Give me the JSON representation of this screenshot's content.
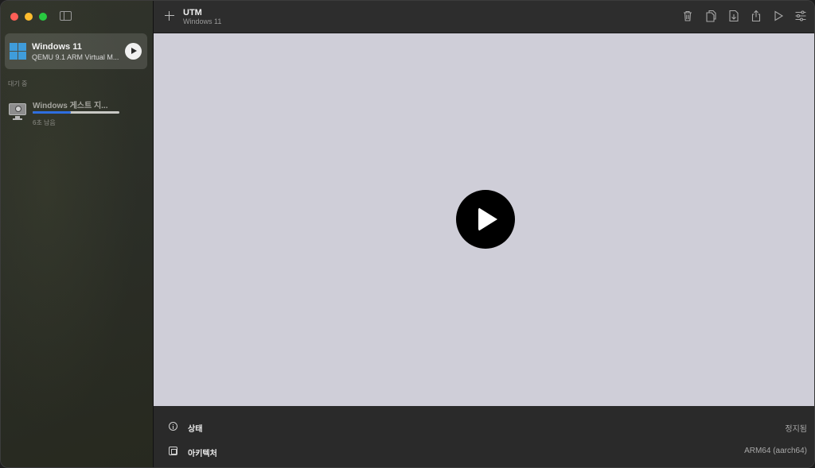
{
  "sidebar": {
    "vm_selected": {
      "name": "Windows 11",
      "subtitle": "QEMU 9.1 ARM Virtual M...",
      "icon": "windows-logo-icon"
    },
    "section_label": "대기 중",
    "download": {
      "title": "Windows 게스트 지...",
      "eta": "6초 남음",
      "progress": 0.44,
      "icon": "monitor-icon"
    }
  },
  "toolbar": {
    "title": "UTM",
    "subtitle": "Windows 11",
    "icons": [
      "trash-icon",
      "clone-icon",
      "download-file-icon",
      "share-icon",
      "run-icon",
      "settings-sliders-icon"
    ]
  },
  "display": {
    "background": "#cfced8",
    "play_icon": "play-icon"
  },
  "info": {
    "rows": [
      {
        "label": "상태",
        "value": "정지됨",
        "icon": "info-circle-icon"
      },
      {
        "label": "아키텍처",
        "value": "ARM64 (aarch64)",
        "icon": "cpu-chip-icon"
      }
    ]
  }
}
